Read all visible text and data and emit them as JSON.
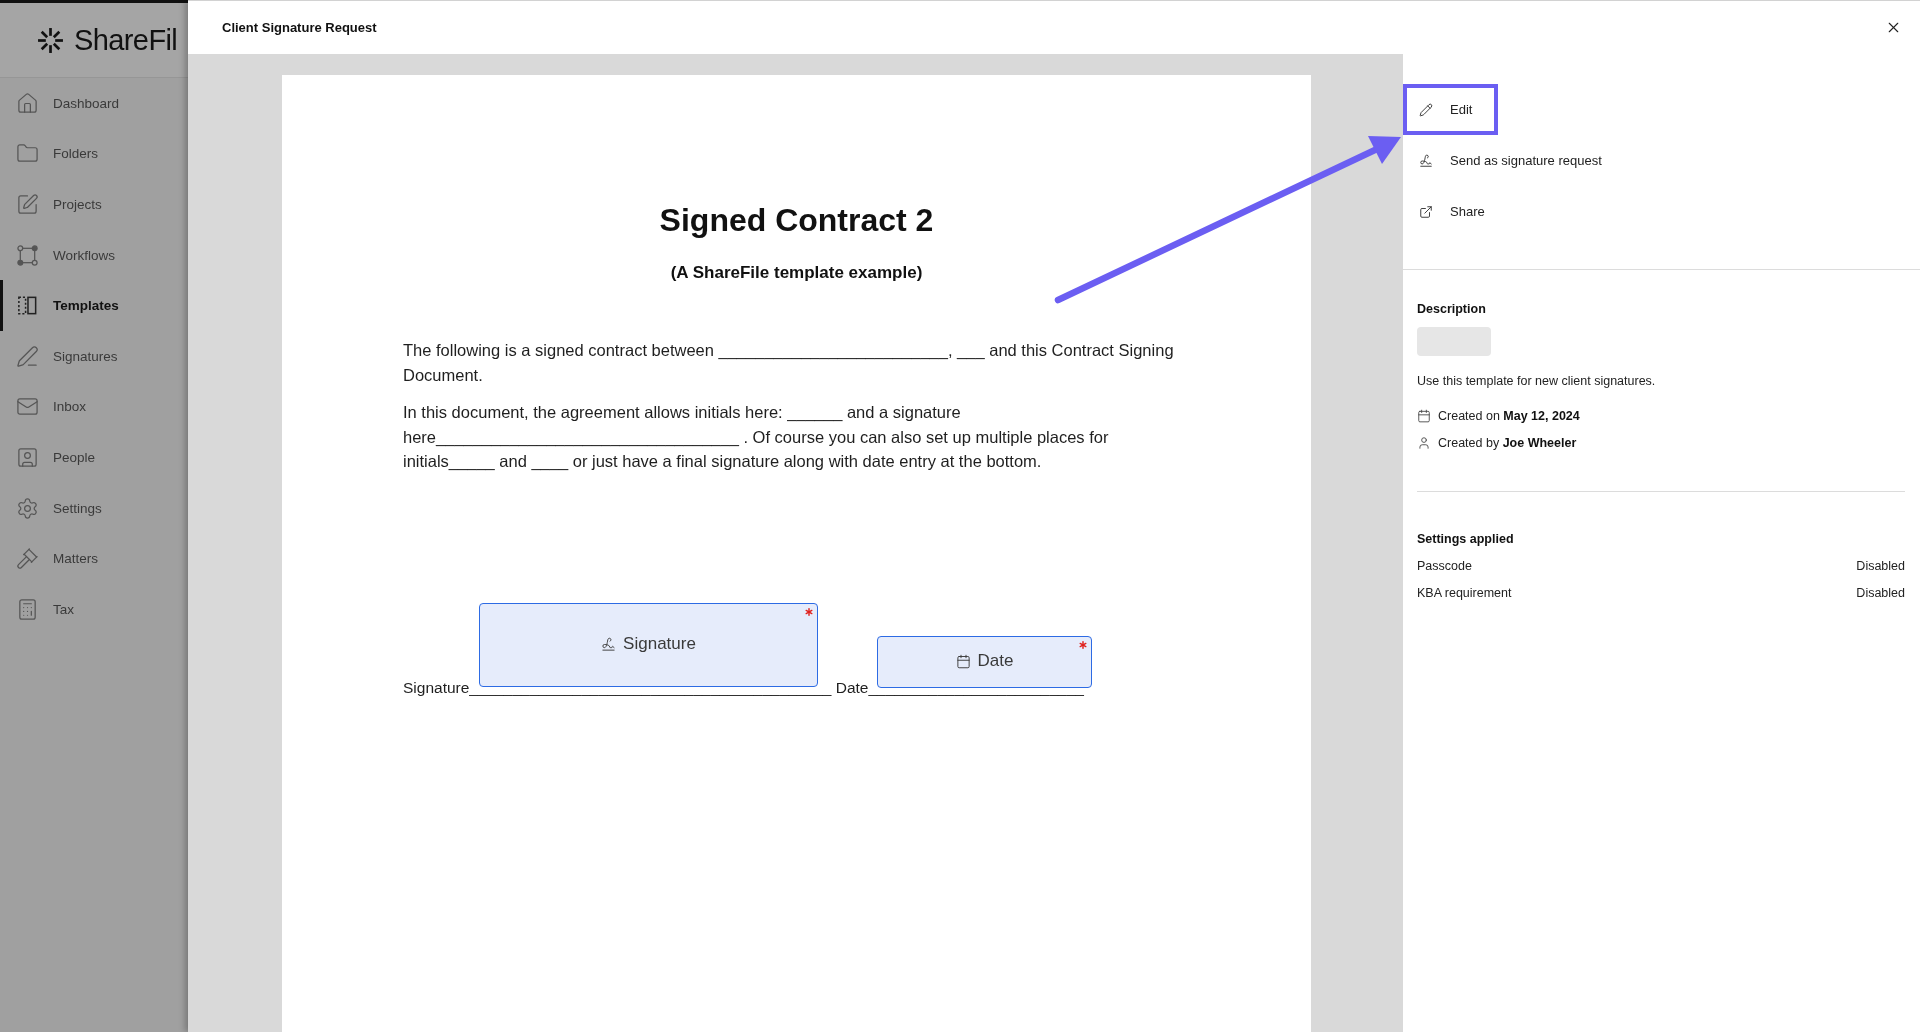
{
  "sidebar": {
    "logo": "ShareFil",
    "items": [
      {
        "label": "Dashboard",
        "selected": false
      },
      {
        "label": "Folders",
        "selected": false
      },
      {
        "label": "Projects",
        "selected": false
      },
      {
        "label": "Workflows",
        "selected": false
      },
      {
        "label": "Templates",
        "selected": true
      },
      {
        "label": "Signatures",
        "selected": false
      },
      {
        "label": "Inbox",
        "selected": false
      },
      {
        "label": "People",
        "selected": false
      },
      {
        "label": "Settings",
        "selected": false
      },
      {
        "label": "Matters",
        "selected": false
      },
      {
        "label": "Tax",
        "selected": false
      }
    ]
  },
  "dialog": {
    "title": "Client Signature Request"
  },
  "document": {
    "title": "Signed Contract 2",
    "subtitle": "(A ShareFile template example)",
    "paragraphs": [
      {
        "lines": [
          "The following is a signed contract between _________________________, ___ and this Contract Signing",
          "Document."
        ]
      },
      {
        "lines": [
          "In this document, the agreement allows initials here: ______ and a signature",
          "here_________________________________ . Of course you can also set up multiple places for",
          "initials_____ and ____ or just have a final signature along with date entry at the bottom."
        ]
      }
    ],
    "signature_line": "Signature__________________________________________ Date_________________________",
    "fields": [
      {
        "kind": "signature",
        "label": "Signature",
        "required": true
      },
      {
        "kind": "date",
        "label": "Date",
        "required": true
      }
    ]
  },
  "actions": [
    {
      "label": "Edit",
      "highlighted": true
    },
    {
      "label": "Send as signature request",
      "highlighted": false
    },
    {
      "label": "Share",
      "highlighted": false
    }
  ],
  "details": {
    "heading": "Description",
    "description": "Use this template for new client signatures.",
    "created_on": "Created on **May 12, 2024**",
    "created_by": "Created by **Joe Wheeler**"
  },
  "settings": {
    "heading": "Settings applied",
    "rows": [
      {
        "name": "Passcode",
        "value": "Disabled"
      },
      {
        "name": "KBA requirement",
        "value": "Disabled"
      }
    ]
  }
}
